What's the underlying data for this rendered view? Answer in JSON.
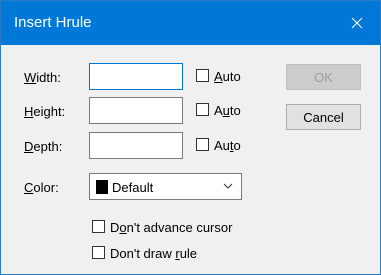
{
  "dialog": {
    "title": "Insert Hrule",
    "close_icon": "close-icon"
  },
  "fields": {
    "width": {
      "label_pre": "",
      "label_key": "W",
      "label_post": "idth:",
      "value": "",
      "auto_pre": "",
      "auto_key": "A",
      "auto_post": "uto",
      "auto_checked": false
    },
    "height": {
      "label_pre": "",
      "label_key": "H",
      "label_post": "eight:",
      "value": "",
      "auto_pre": "A",
      "auto_key": "u",
      "auto_post": "to",
      "auto_checked": false
    },
    "depth": {
      "label_pre": "",
      "label_key": "D",
      "label_post": "epth:",
      "value": "",
      "auto_pre": "Au",
      "auto_key": "t",
      "auto_post": "o",
      "auto_checked": false
    }
  },
  "color": {
    "label_pre": "",
    "label_key": "C",
    "label_post": "olor:",
    "value": "Default",
    "swatch": "#000000"
  },
  "options": {
    "dont_advance": {
      "pre": "D",
      "key": "o",
      "post": "n't advance cursor",
      "checked": false
    },
    "dont_draw": {
      "pre": "Don't draw ",
      "key": "r",
      "post": "ule",
      "checked": false
    }
  },
  "buttons": {
    "ok": "OK",
    "cancel": "Cancel"
  },
  "colors": {
    "titlebar": "#0078d7",
    "focus_border": "#0078d7"
  }
}
